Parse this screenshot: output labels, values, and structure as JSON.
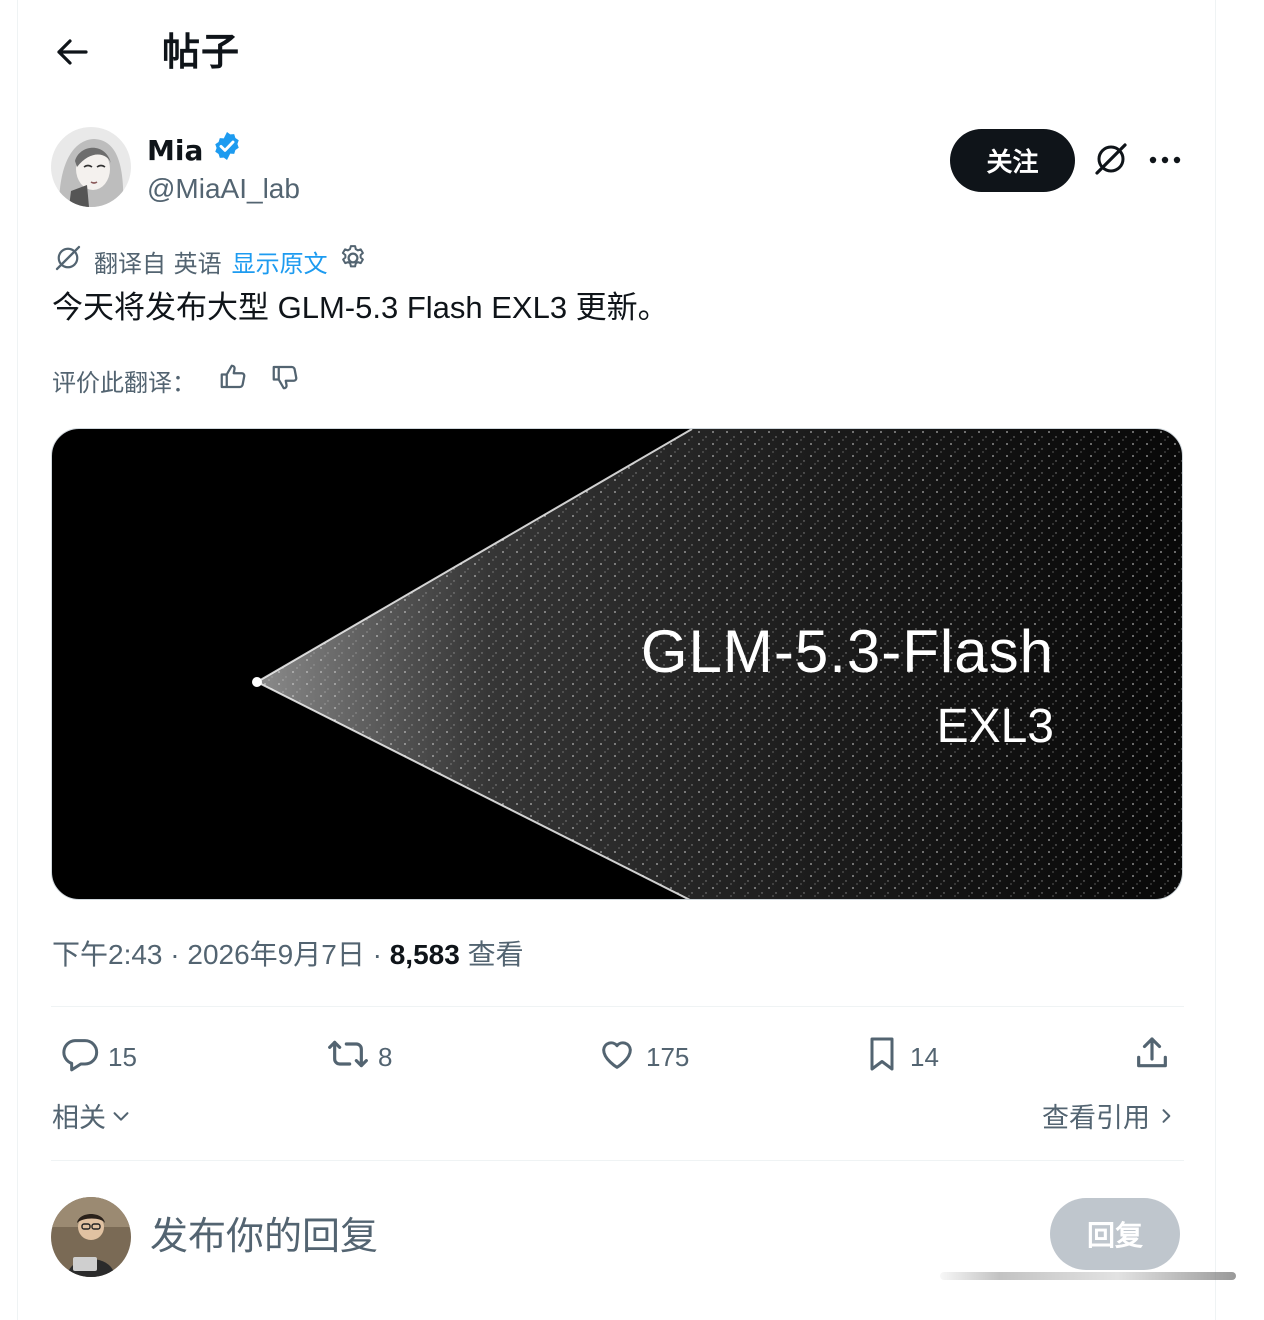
{
  "header": {
    "title": "帖子"
  },
  "author": {
    "name": "Mia",
    "handle": "@MiaAI_lab",
    "verified": true
  },
  "actions_top": {
    "follow_label": "关注"
  },
  "translation": {
    "translated_from": "翻译自 英语",
    "show_original": "显示原文"
  },
  "tweet": {
    "text": "今天将发布大型 GLM-5.3 Flash EXL3 更新。"
  },
  "rate": {
    "label": "评价此翻译："
  },
  "media": {
    "title": "GLM-5.3-Flash",
    "subtitle": "EXL3"
  },
  "meta": {
    "time": "下午2:43",
    "date": "2026年9月7日",
    "views_count": "8,583",
    "views_label": "查看"
  },
  "engagement": {
    "replies": "15",
    "retweets": "8",
    "likes": "175",
    "bookmarks": "14"
  },
  "related": {
    "label": "相关",
    "view_quotes": "查看引用"
  },
  "reply": {
    "placeholder": "发布你的回复",
    "button_label": "回复"
  },
  "colors": {
    "text_primary": "#0f1419",
    "text_secondary": "#536471",
    "link": "#1d9bf0",
    "verified": "#1d9bf0"
  }
}
